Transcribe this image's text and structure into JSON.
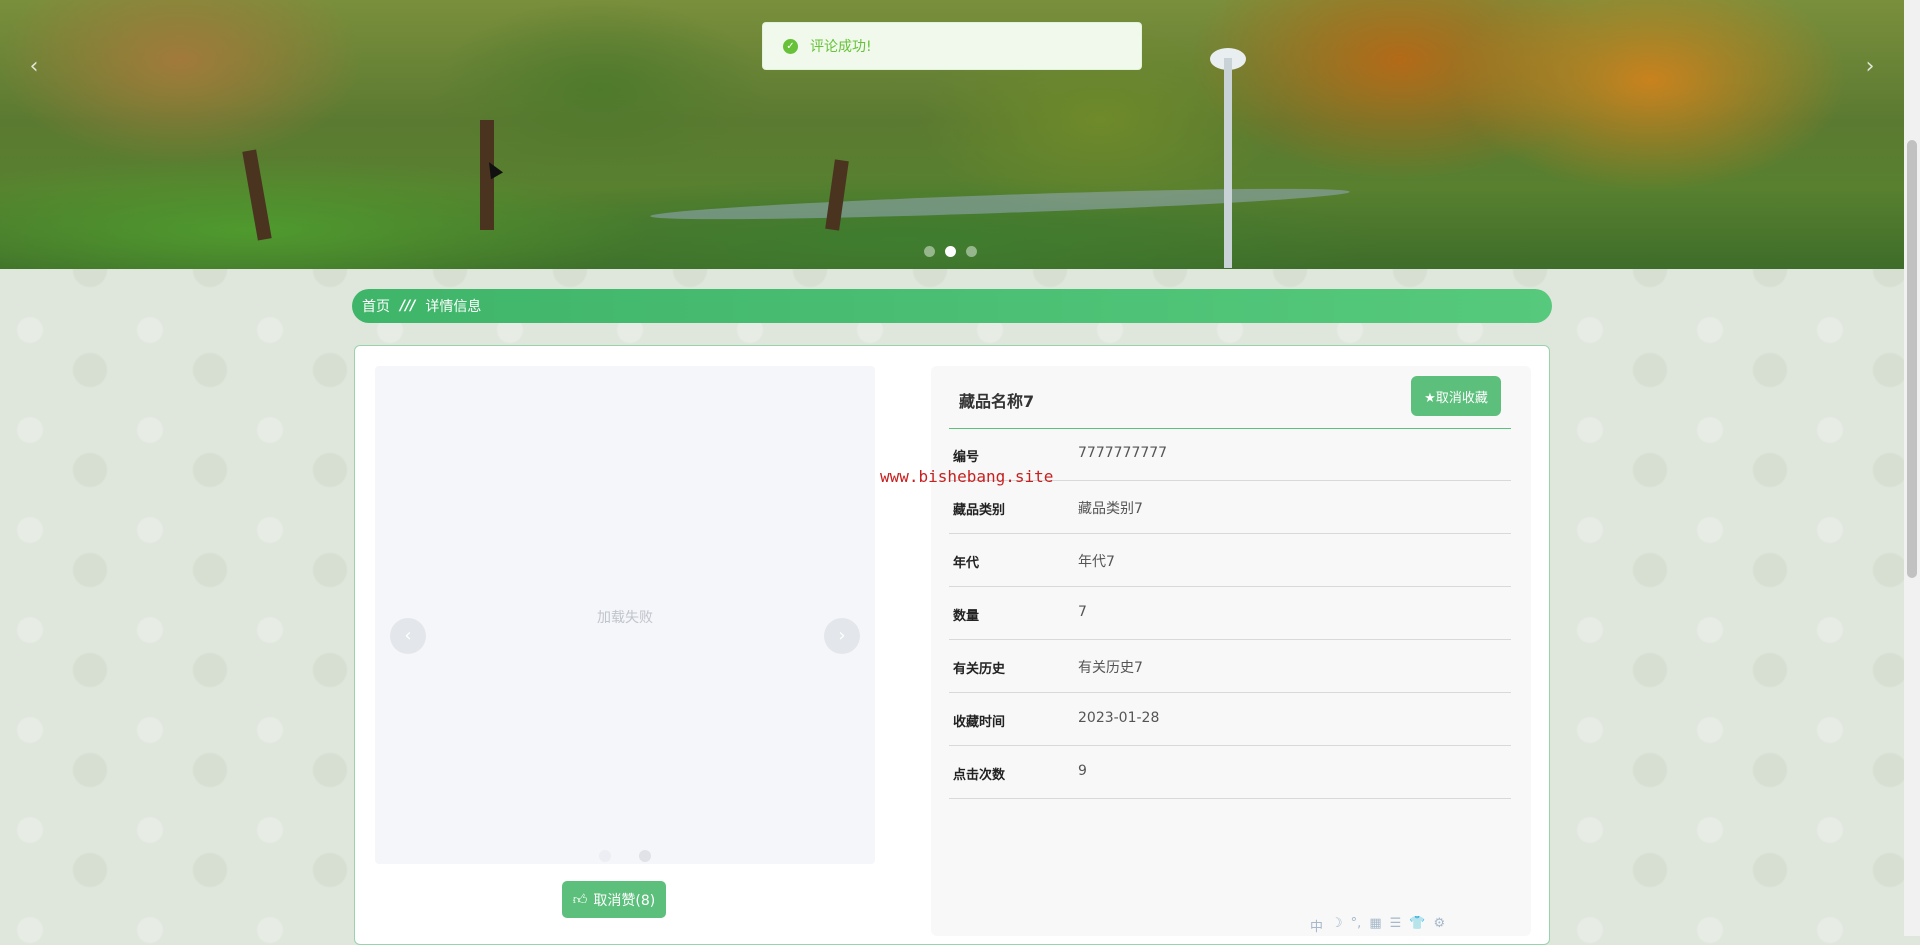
{
  "toast": {
    "message": "评论成功!",
    "icon": "check-circle-icon",
    "color": "#67c23a"
  },
  "banner": {
    "prev": "‹",
    "next": "›",
    "slide_count": 3,
    "active_slide": 2
  },
  "breadcrumb": {
    "home": "首页",
    "separator": "///",
    "current": "详情信息"
  },
  "gallery": {
    "fail_text": "加载失败",
    "prev": "‹",
    "next": "›",
    "indicator_count": 2,
    "active_indicator": 2
  },
  "like_button": {
    "label": "取消赞(8)",
    "icon": "thumbs-up-icon"
  },
  "item": {
    "title": "藏品名称7",
    "favorite_button": "★取消收藏",
    "fields": [
      {
        "key": "编号",
        "value": "7777777777"
      },
      {
        "key": "藏品类别",
        "value": "藏品类别7"
      },
      {
        "key": "年代",
        "value": "年代7"
      },
      {
        "key": "数量",
        "value": "7"
      },
      {
        "key": "有关历史",
        "value": "有关历史7"
      },
      {
        "key": "收藏时间",
        "value": "2023-01-28"
      },
      {
        "key": "点击次数",
        "value": "9"
      }
    ]
  },
  "watermark": "www.bishebang.site",
  "ime_toolbar": [
    "中",
    "☽",
    "°,",
    "▦",
    "☰",
    "👕",
    "⚙"
  ],
  "colors": {
    "accent": "#5cbf7c",
    "breadcrumb": "#3fb56a",
    "watermark": "#c81f1f"
  }
}
